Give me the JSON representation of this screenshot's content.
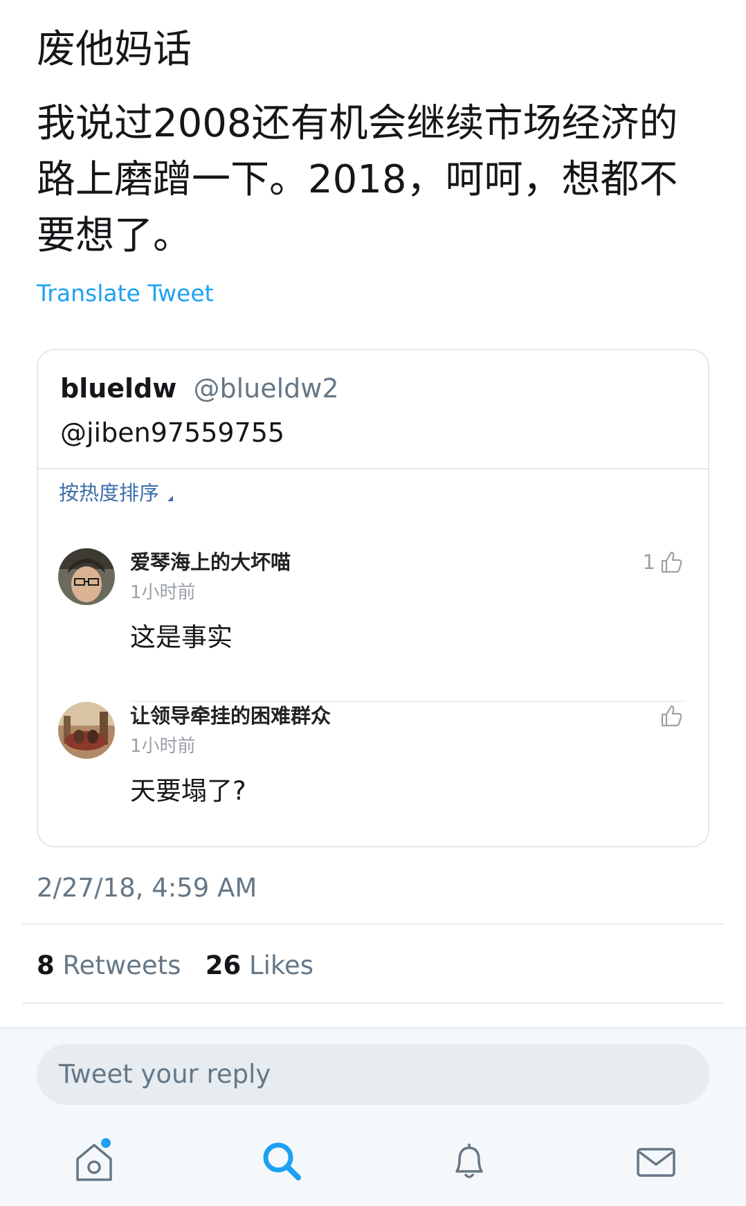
{
  "tweet": {
    "line1": "废他妈话",
    "body": "我说过2008还有机会继续市场经济的\n路上磨蹭一下。2018，呵呵，想都不\n要想了。",
    "translate_label": "Translate Tweet"
  },
  "quote": {
    "name": "blueldw",
    "handle": "@blueldw2",
    "mention": "@jiben97559755",
    "sort_label": "按热度排序",
    "comments": [
      {
        "user": "爱琴海上的大坏喵",
        "time": "1小时前",
        "text": "这是事实",
        "likes": "1"
      },
      {
        "user": "让领导牵挂的困难群众",
        "time": "1小时前",
        "text": "天要塌了?",
        "likes": ""
      }
    ]
  },
  "meta": {
    "timestamp": "2/27/18, 4:59 AM",
    "retweets_count": "8",
    "retweets_label": "Retweets",
    "likes_count": "26",
    "likes_label": "Likes"
  },
  "reply": {
    "placeholder": "Tweet your reply"
  },
  "nav": {
    "items": [
      "home-icon",
      "search-icon",
      "notifications-icon",
      "messages-icon"
    ],
    "active": "search-icon",
    "accent": "#1da1f2"
  }
}
